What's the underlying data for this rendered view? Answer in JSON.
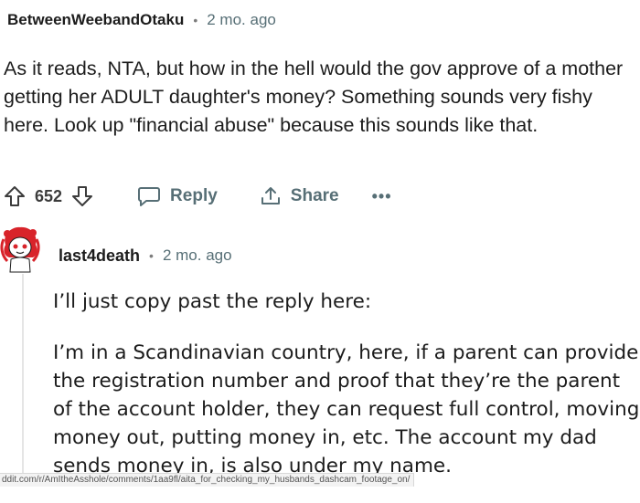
{
  "comment": {
    "author": "BetweenWeebandOtaku",
    "separator": "•",
    "age": "2 mo. ago",
    "body": "As it reads, NTA, but how in the hell would the gov approve of a mother getting her ADULT daughter's money? Something sounds very fishy here. Look up \"financial abuse\" because this sounds like that.",
    "vote_count": "652",
    "reply_label": "Reply",
    "share_label": "Share",
    "more_label": "•••"
  },
  "reply": {
    "author": "last4death",
    "separator": "•",
    "age": "2 mo. ago",
    "paragraph1": "I’ll just copy past the reply here:",
    "paragraph2": "I’m in a Scandinavian country, here, if a parent can provide the registration number and proof that they’re the parent of the account holder, they can request full control, moving money out, putting money in, etc. The account my dad sends money in, is also under my name."
  },
  "status_url": "ddit.com/r/AmItheAsshole/comments/1aa9fl/aita_for_checking_my_husbands_dashcam_footage_on/",
  "icons": {
    "upvote": "upvote-arrow-icon",
    "downvote": "downvote-arrow-icon",
    "reply": "speech-bubble-icon",
    "share": "share-arrow-icon",
    "more": "ellipsis-icon",
    "avatar": "snoo-avatar-red-hair"
  },
  "colors": {
    "text": "#1c1c1c",
    "meta": "#576f76",
    "avatar_hair": "#d8232a"
  }
}
